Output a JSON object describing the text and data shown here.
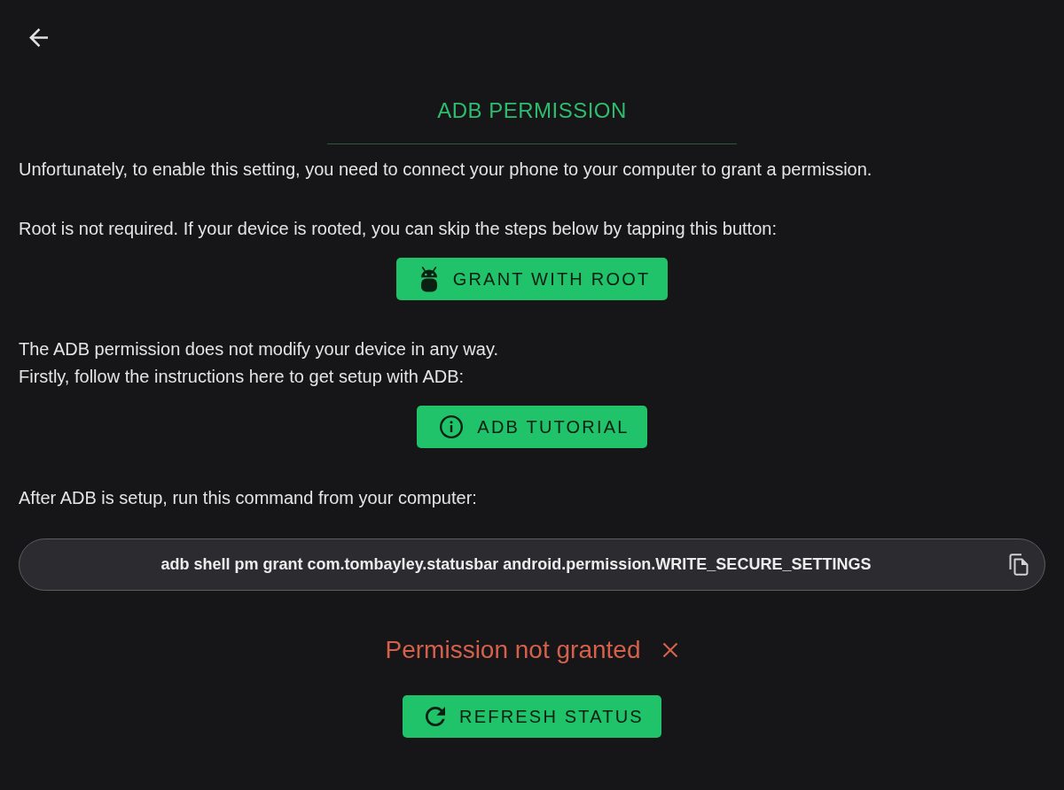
{
  "title": "ADB PERMISSION",
  "intro": "Unfortunately, to enable this setting, you need to connect your phone to your computer to grant a permission.",
  "root": {
    "text": "Root is not required. If your device is rooted, you can skip the steps below by tapping this button:",
    "button": "GRANT WITH ROOT"
  },
  "adb": {
    "lines": [
      "The ADB permission does not modify your device in any way.",
      "Firstly, follow the instructions here to get setup with ADB:"
    ],
    "button": "ADB TUTORIAL"
  },
  "command": {
    "text": "After ADB is setup, run this command from your computer:",
    "value": "adb shell pm grant com.tombayley.statusbar android.permission.WRITE_SECURE_SETTINGS"
  },
  "status": {
    "text": "Permission not granted",
    "granted": false,
    "button": "REFRESH STATUS"
  }
}
